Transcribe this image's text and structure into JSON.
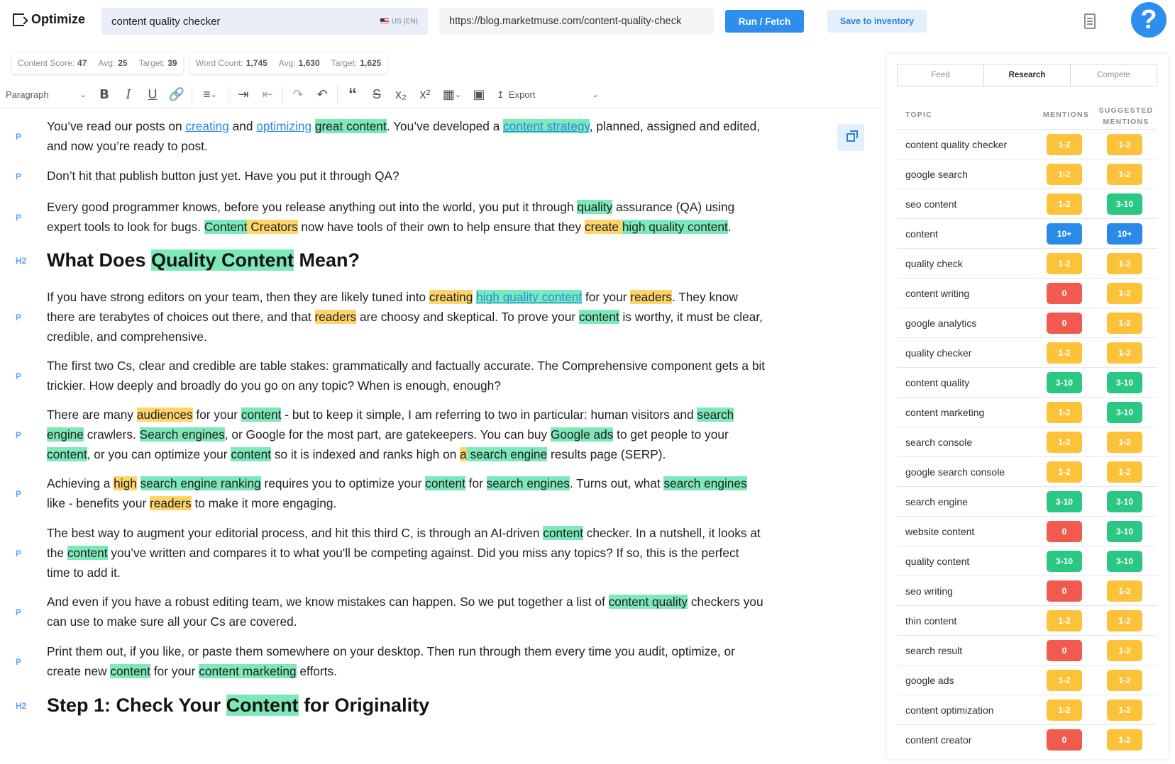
{
  "app": {
    "title": "Optimize"
  },
  "topbar": {
    "keyword": "content quality checker",
    "locale": "US (EN)",
    "url": "https://blog.marketmuse.com/content-quality-check",
    "run_label": "Run / Fetch",
    "save_label": "Save to inventory",
    "help_label": "?"
  },
  "scores": {
    "content_label": "Content Score:",
    "content_score": "47",
    "content_avg_label": "Avg:",
    "content_avg": "25",
    "content_target_label": "Target:",
    "content_target": "39",
    "word_label": "Word Count:",
    "word_count": "1,745",
    "word_avg_label": "Avg:",
    "word_avg": "1,630",
    "word_target_label": "Target:",
    "word_target": "1,625"
  },
  "toolbar": {
    "block_type": "Paragraph",
    "export_label": "Export"
  },
  "editor": {
    "tags": {
      "p": "P",
      "h2": "H2"
    },
    "p1": [
      "You’ve read our posts on ",
      "creating",
      " and ",
      "optimizing",
      " ",
      "great content",
      ". You’ve developed a ",
      "content strategy",
      ", planned, assigned and edited,",
      "and now you’re ready to post."
    ],
    "p2": "Don’t hit that publish button just yet. Have you put it through QA?",
    "p3": [
      "Every good programmer knows, before you release anything out into the world, you put it through ",
      "quality",
      " assurance (QA) using",
      "expert tools to look for bugs. ",
      "Content",
      " ",
      "Creators",
      " now have tools of their own to help ensure that they ",
      "create",
      " ",
      "high quality content",
      "."
    ],
    "h1": [
      "What Does ",
      "Quality Content",
      " Mean?"
    ],
    "p4": [
      "If you have strong editors on your team, then they are likely tuned into ",
      "creating",
      " ",
      "high quality content",
      " for your ",
      "readers",
      ". They know",
      "there are terabytes of choices out there, and that ",
      "readers",
      " are choosy and skeptical. To prove your ",
      "content",
      " is worthy, it must be clear,",
      "credible, and comprehensive."
    ],
    "p5": [
      "The first two Cs, clear and credible are table stakes: grammatically and factually accurate. The Comprehensive component gets a bit",
      "trickier. How deeply and broadly do you go on any topic? When is enough, enough?"
    ],
    "p6": [
      "There are many ",
      "audiences",
      " for your ",
      "content",
      " - but to keep it simple, I am referring to two in particular: human visitors and ",
      "search",
      "engine",
      " crawlers. ",
      "Search engines",
      ", or Google for the most part, are gatekeepers. You can buy ",
      "Google ads",
      " to get people to your",
      "content",
      ", or you can optimize your ",
      "content",
      " so it is indexed and ranks high on ",
      "a",
      " ",
      "search engine",
      " results page (SERP)."
    ],
    "p7": [
      "Achieving a ",
      "high",
      " ",
      "search engine ranking",
      " requires you to optimize your ",
      "content",
      " for ",
      "search engines",
      ". Turns out, what ",
      "search engines",
      "like - benefits your ",
      "readers",
      " to make it more engaging."
    ],
    "p8": [
      "The best way to augment your editorial process, and hit this third C, is through an AI-driven ",
      "content",
      " checker. In a nutshell, it looks at",
      "the ",
      "content",
      " you’ve written and compares it to what you'll be competing against. Did you miss any topics? If so, this is the perfect",
      "time to add it."
    ],
    "p9": [
      "And even if you have a robust editing team, we know mistakes can happen. So we put together a list of ",
      "content quality",
      " checkers you",
      "can use to make sure all your Cs are covered."
    ],
    "p10": [
      "Print them out, if you like, or paste them somewhere on your desktop. Then run through them every time you audit, optimize, or",
      "create new ",
      "content",
      " for your ",
      "content marketing",
      " efforts."
    ],
    "h2": [
      "Step 1: Check Your ",
      "Content",
      " for Originality"
    ]
  },
  "panel": {
    "tabs": [
      "Feed",
      "Research",
      "Compete"
    ],
    "active_tab": "Research",
    "headers": {
      "topic": "TOPIC",
      "mentions": "MENTIONS",
      "suggested_1": "SUGGESTED",
      "suggested_2": "MENTIONS"
    },
    "rows": [
      {
        "topic": "content quality checker",
        "mentions": "1-2",
        "suggested": "1-2"
      },
      {
        "topic": "google search",
        "mentions": "1-2",
        "suggested": "1-2"
      },
      {
        "topic": "seo content",
        "mentions": "1-2",
        "suggested": "3-10"
      },
      {
        "topic": "content",
        "mentions": "10+",
        "suggested": "10+"
      },
      {
        "topic": "quality check",
        "mentions": "1-2",
        "suggested": "1-2"
      },
      {
        "topic": "content writing",
        "mentions": "0",
        "suggested": "1-2"
      },
      {
        "topic": "google analytics",
        "mentions": "0",
        "suggested": "1-2"
      },
      {
        "topic": "quality checker",
        "mentions": "1-2",
        "suggested": "1-2"
      },
      {
        "topic": "content quality",
        "mentions": "3-10",
        "suggested": "3-10"
      },
      {
        "topic": "content marketing",
        "mentions": "1-2",
        "suggested": "3-10"
      },
      {
        "topic": "search console",
        "mentions": "1-2",
        "suggested": "1-2"
      },
      {
        "topic": "google search console",
        "mentions": "1-2",
        "suggested": "1-2"
      },
      {
        "topic": "search engine",
        "mentions": "3-10",
        "suggested": "3-10"
      },
      {
        "topic": "website content",
        "mentions": "0",
        "suggested": "3-10"
      },
      {
        "topic": "quality content",
        "mentions": "3-10",
        "suggested": "3-10"
      },
      {
        "topic": "seo writing",
        "mentions": "0",
        "suggested": "1-2"
      },
      {
        "topic": "thin content",
        "mentions": "1-2",
        "suggested": "1-2"
      },
      {
        "topic": "search result",
        "mentions": "0",
        "suggested": "1-2"
      },
      {
        "topic": "google ads",
        "mentions": "1-2",
        "suggested": "1-2"
      },
      {
        "topic": "content optimization",
        "mentions": "1-2",
        "suggested": "1-2"
      },
      {
        "topic": "content creator",
        "mentions": "0",
        "suggested": "1-2"
      }
    ],
    "colors": {
      "1-2": "#fcc23a",
      "3-10": "#2bc784",
      "10+": "#2b8ae8",
      "0": "#f15a4f"
    }
  }
}
